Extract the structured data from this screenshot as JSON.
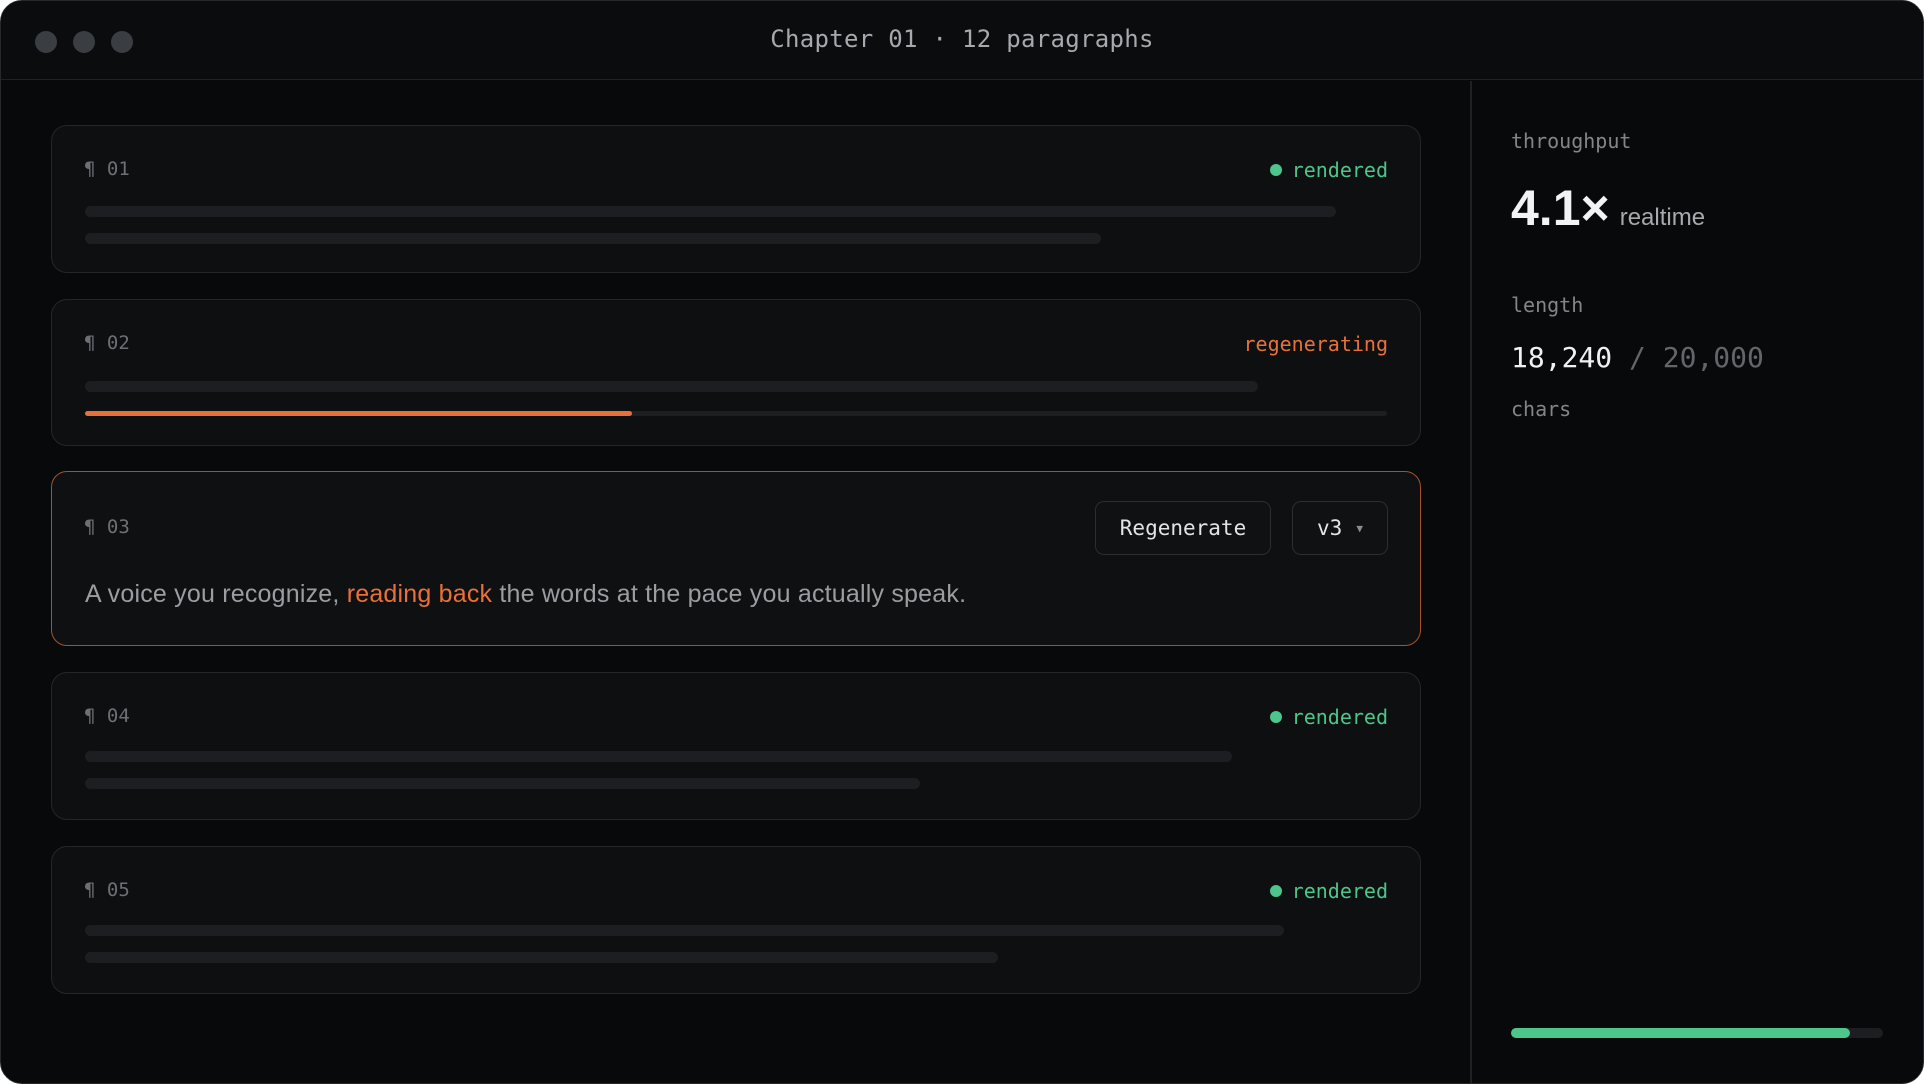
{
  "window": {
    "title": "Chapter 01 · 12 paragraphs"
  },
  "paragraphs": [
    {
      "number": "¶ 01",
      "status": "rendered",
      "status_tone": "green"
    },
    {
      "number": "¶ 02",
      "status": "regenerating",
      "status_tone": "orange",
      "progress_fraction": 0.42
    },
    {
      "number": "¶ 03",
      "active": true,
      "regenerate_label": "Regenerate",
      "version": "v3",
      "text_before": "A voice you recognize, ",
      "text_highlight": "reading back",
      "text_after": " the words at the pace you actually speak."
    },
    {
      "number": "¶ 04",
      "status": "rendered",
      "status_tone": "green"
    },
    {
      "number": "¶ 05",
      "status": "rendered",
      "status_tone": "green"
    }
  ],
  "sidebar": {
    "throughput_label": "throughput",
    "throughput_value": "4.1×",
    "throughput_unit": "realtime",
    "length_label": "length",
    "length_current": "18,240",
    "length_separator": "/",
    "length_max": "20,000",
    "length_unit": "chars",
    "quota_fraction": 0.912
  },
  "colors": {
    "accent_orange": "#e8703a",
    "success_green": "#4cc68a",
    "background": "#08090a"
  }
}
